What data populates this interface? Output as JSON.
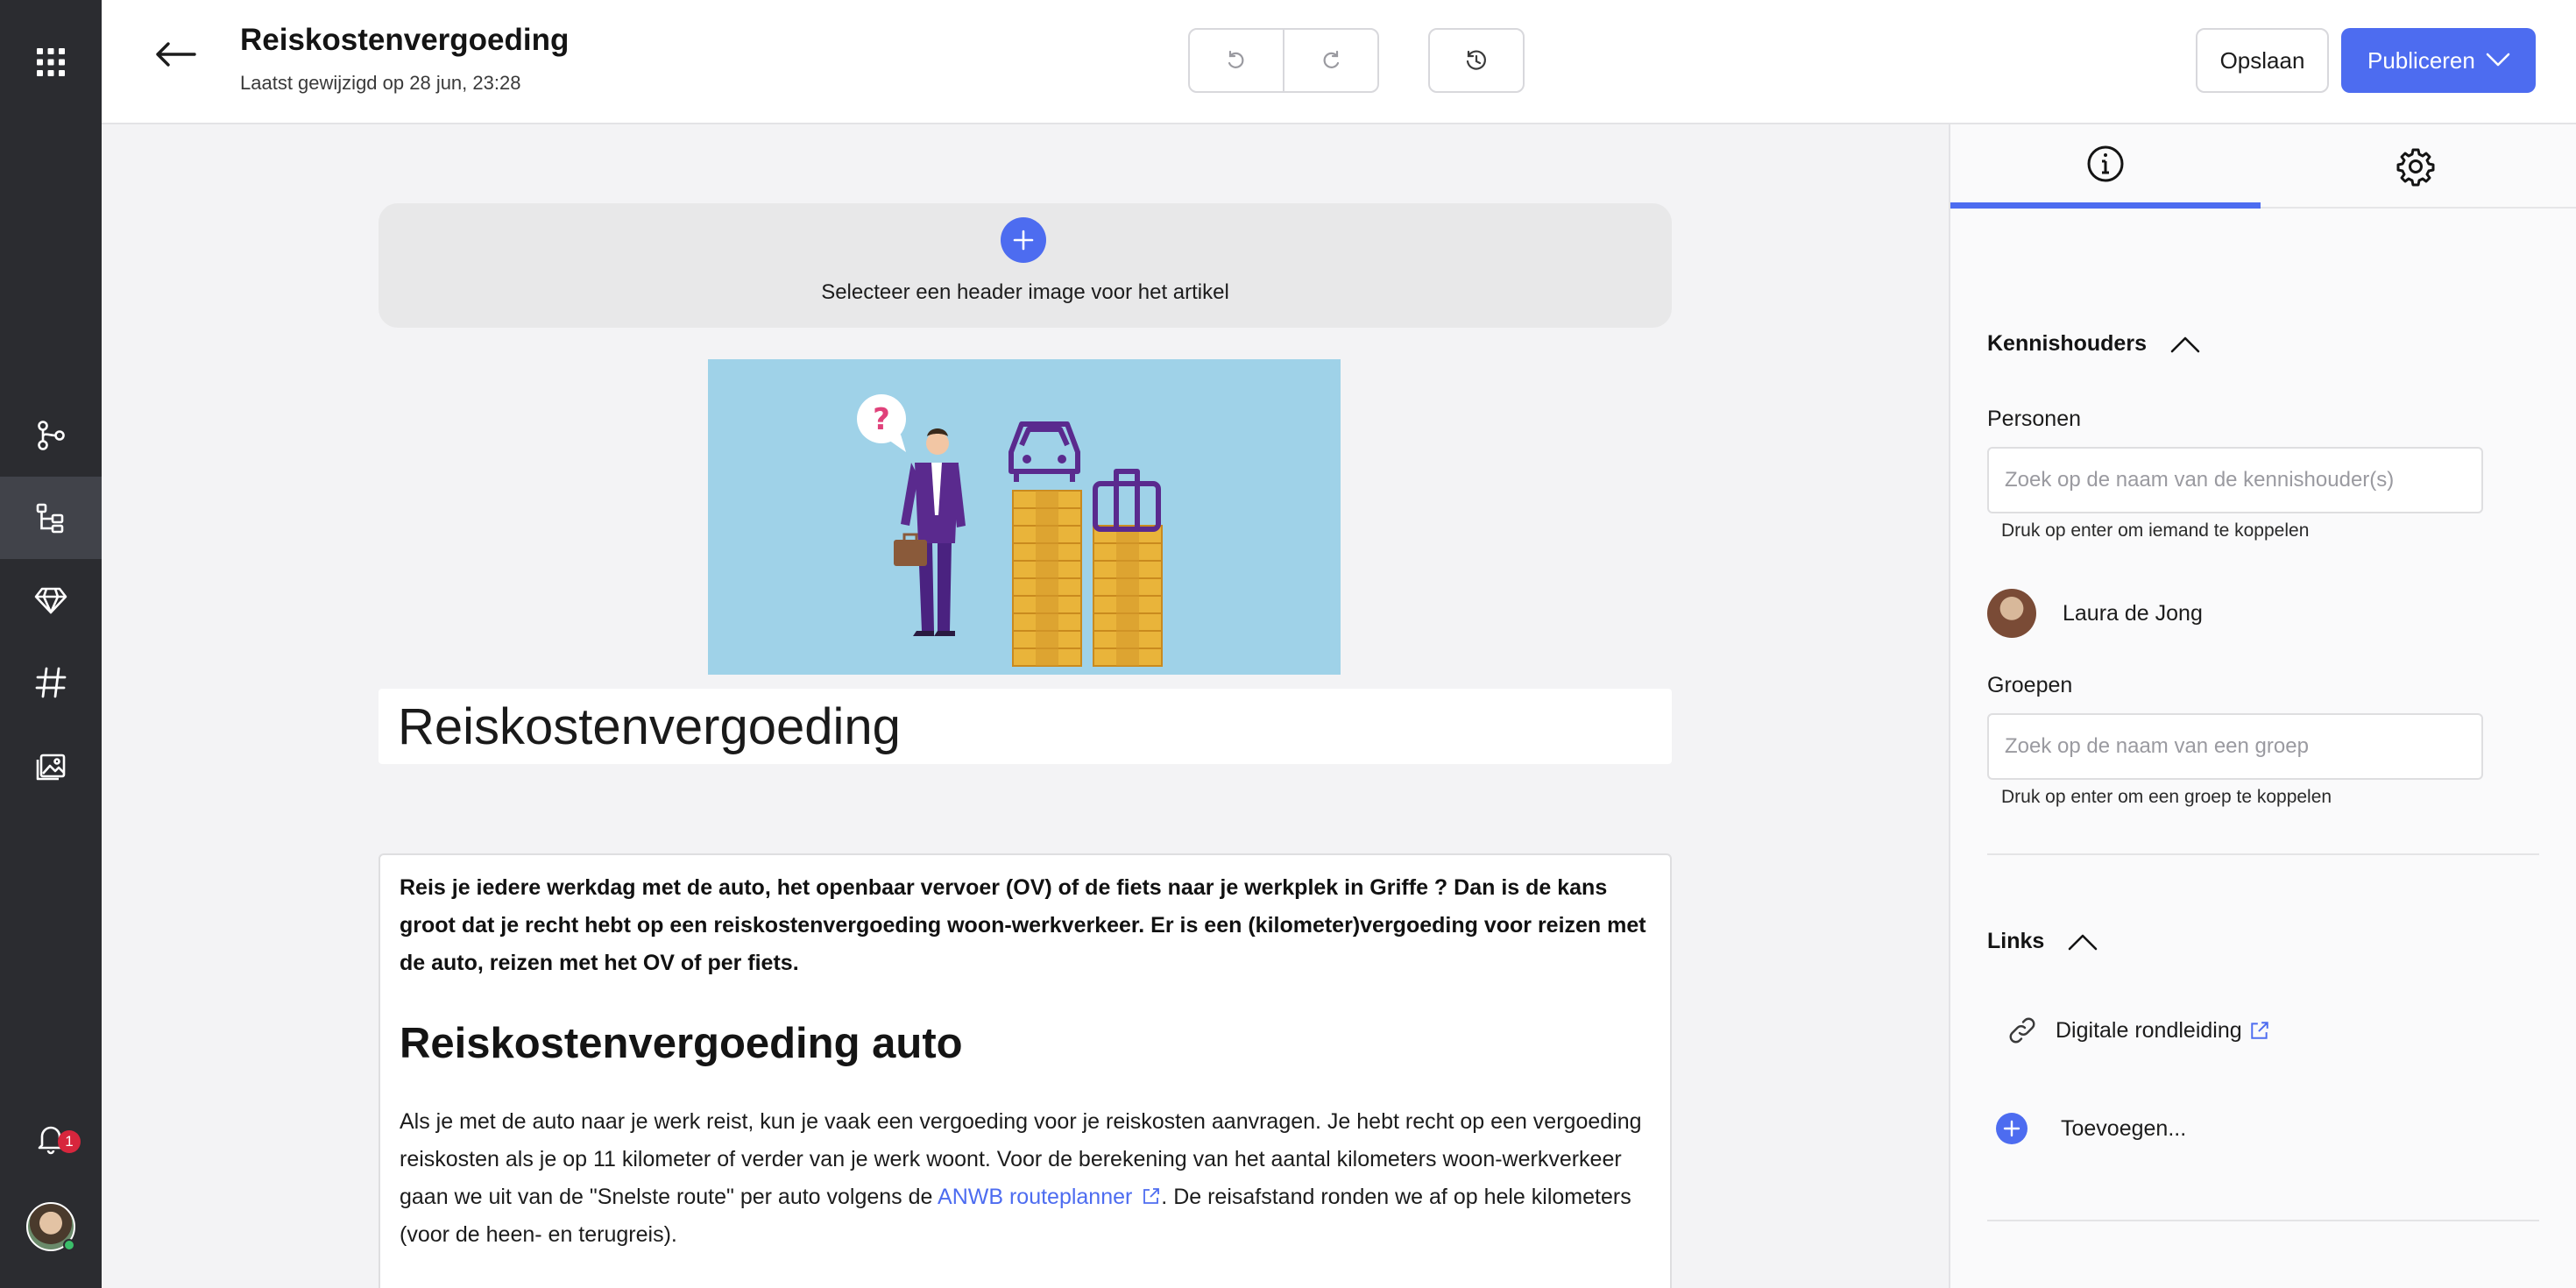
{
  "sidebar": {
    "icons": [
      "apps-grid-icon",
      "workflow-icon",
      "article-tree-icon",
      "diamond-icon",
      "hashtag-icon",
      "media-gallery-icon",
      "notification-bell-icon"
    ],
    "notification_count": "1"
  },
  "header": {
    "title": "Reiskostenvergoeding",
    "subtitle": "Laatst gewijzigd op 28 jun, 23:28",
    "save_label": "Opslaan",
    "publish_label": "Publiceren"
  },
  "editor": {
    "header_image_prompt": "Selecteer een header image voor het artikel",
    "article_title": "Reiskostenvergoeding",
    "lead": "Reis je iedere werkdag met de auto, het openbaar vervoer (OV) of de fiets naar je werkplek in Griffe ? Dan is de kans groot dat je recht hebt op een reiskostenvergoeding woon-werkverkeer. Er is een (kilometer)vergoeding voor reizen met de auto, reizen met het OV of per fiets.",
    "heading": "Reiskostenvergoeding auto",
    "paragraph_before_link": "Als je met de auto naar je werk reist, kun je vaak een vergoeding voor je reiskosten aanvragen. Je hebt recht op een vergoeding reiskosten als je op 11 kilometer of verder van je werk woont. Voor de berekening van het aantal kilometers woon-werkverkeer gaan we uit van de \"Snelste route\" per auto volgens de ",
    "paragraph_link": "ANWB routeplanner",
    "paragraph_after_link": ". De reisafstand ronden we af op hele kilometers (voor de heen- en terugreis)."
  },
  "panel": {
    "kennishouders": {
      "heading": "Kennishouders",
      "persons_label": "Personen",
      "persons_placeholder": "Zoek op de naam van de kennishouder(s)",
      "persons_hint": "Druk op enter om iemand te koppelen",
      "person_name": "Laura de Jong",
      "groups_label": "Groepen",
      "groups_placeholder": "Zoek op de naam van een groep",
      "groups_hint": "Druk op enter om een groep te koppelen"
    },
    "links": {
      "heading": "Links",
      "item": "Digitale rondleiding",
      "add_label": "Toevoegen..."
    }
  },
  "colors": {
    "accent": "#4d6cf0",
    "rail": "#2b2c30",
    "badge": "#d7263d"
  }
}
